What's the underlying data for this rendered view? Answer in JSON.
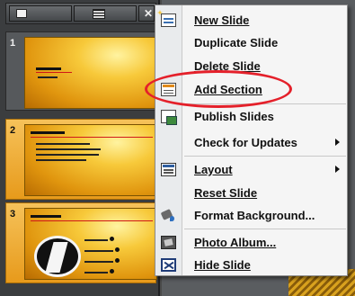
{
  "panel": {
    "tabs": [
      {
        "name": "slides",
        "icon": "slide-thumbnail-icon"
      },
      {
        "name": "outline",
        "icon": "outline-list-icon"
      },
      {
        "name": "close",
        "glyph": "✕"
      }
    ],
    "slides": [
      {
        "number": "1",
        "selected": false
      },
      {
        "number": "2",
        "selected": true
      },
      {
        "number": "3",
        "selected": true
      }
    ]
  },
  "menu": {
    "items": [
      {
        "label": "New Slide",
        "mnemonic": "N",
        "icon": "new-slide-icon"
      },
      {
        "label": "Duplicate Slide",
        "mnemonic": "a",
        "icon": null
      },
      {
        "label": "Delete Slide",
        "mnemonic": "D",
        "icon": null
      },
      {
        "label": "Add Section",
        "mnemonic": "A",
        "icon": "add-section-icon"
      },
      {
        "label": "Publish Slides",
        "mnemonic": "S",
        "icon": "publish-slides-icon"
      },
      {
        "label": "Check for Updates",
        "mnemonic": "U",
        "icon": null,
        "submenu": true
      },
      {
        "label": "Layout",
        "mnemonic": "L",
        "icon": "layout-icon",
        "submenu": true
      },
      {
        "label": "Reset Slide",
        "mnemonic": "R",
        "icon": null
      },
      {
        "label": "Format Background...",
        "mnemonic": "B",
        "icon": "format-background-icon"
      },
      {
        "label": "Photo Album...",
        "mnemonic": "P",
        "icon": "photo-album-icon"
      },
      {
        "label": "Hide Slide",
        "mnemonic": "H",
        "icon": "hide-slide-icon"
      }
    ]
  },
  "annotation": {
    "highlighted_item": "Add Section",
    "color": "#e4202a"
  }
}
